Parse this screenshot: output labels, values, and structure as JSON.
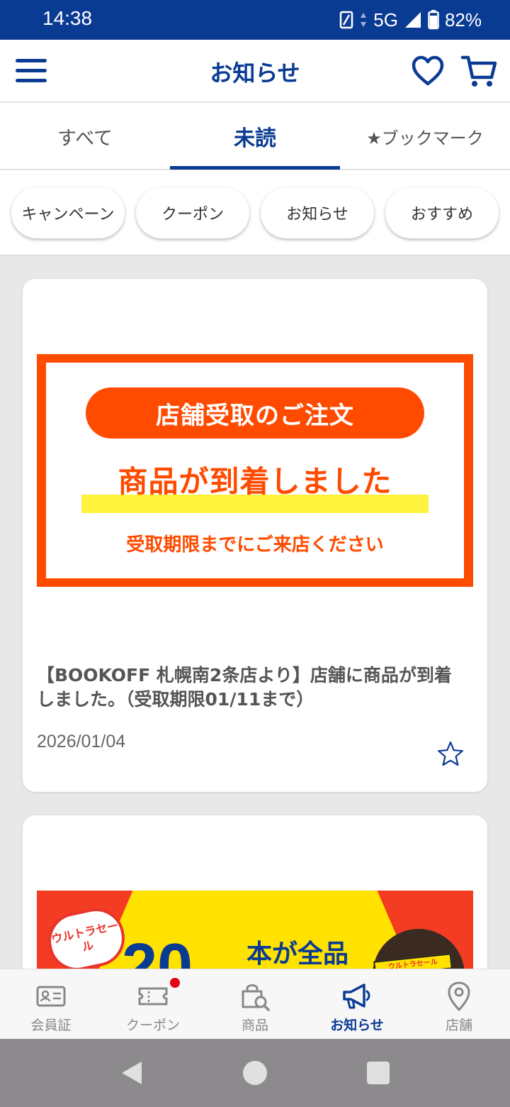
{
  "status_bar": {
    "time": "14:38",
    "network": "5G",
    "battery": "82%"
  },
  "header": {
    "title": "お知らせ"
  },
  "tabs": [
    {
      "label": "すべて",
      "active": false
    },
    {
      "label": "未読",
      "active": true
    },
    {
      "label": "★ブックマーク",
      "active": false
    }
  ],
  "filters": [
    {
      "label": "キャンペーン"
    },
    {
      "label": "クーポン"
    },
    {
      "label": "お知らせ"
    },
    {
      "label": "おすすめ"
    }
  ],
  "notices": [
    {
      "banner": {
        "pill": "店舗受取のご注文",
        "main": "商品が到着しました",
        "sub": "受取期限までにご来店ください"
      },
      "title": "【BOOKOFF 札幌南2条店より】店舗に商品が到着しました。（受取期限01/11まで）",
      "date": "2026/01/04",
      "bookmarked": false
    },
    {
      "banner": {
        "badge": "ウルトラセール",
        "big_number": "20",
        "text": "本が全品",
        "headband": "ウルトラセール"
      }
    }
  ],
  "bottom_nav": [
    {
      "label": "会員証",
      "icon": "member-card-icon",
      "active": false
    },
    {
      "label": "クーポン",
      "icon": "coupon-ticket-icon",
      "active": false,
      "has_notification": true
    },
    {
      "label": "商品",
      "icon": "product-search-icon",
      "active": false
    },
    {
      "label": "お知らせ",
      "icon": "megaphone-icon",
      "active": true
    },
    {
      "label": "店舗",
      "icon": "location-pin-icon",
      "active": false
    }
  ],
  "colors": {
    "primary": "#0a3b93",
    "accent_orange": "#ff4b00",
    "highlight_yellow": "#fff23c",
    "notification_red": "#e60012"
  }
}
